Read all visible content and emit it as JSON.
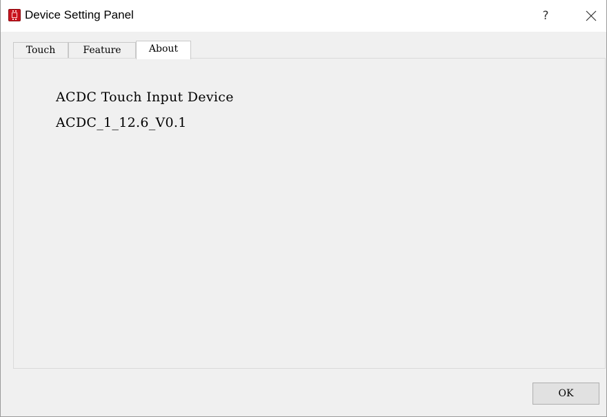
{
  "window": {
    "title": "Device Setting Panel",
    "help_label": "?",
    "app_icon": "chip-icon",
    "close_icon": "close-icon"
  },
  "tabs": [
    {
      "label": "Touch",
      "active": false
    },
    {
      "label": "Feature",
      "active": false
    },
    {
      "label": "About",
      "active": true
    }
  ],
  "about": {
    "device_name": "ACDC Touch Input Device",
    "version": "ACDC_1_12.6_V0.1"
  },
  "footer": {
    "ok_label": "OK"
  },
  "colors": {
    "app_icon": "#c8141e",
    "window_bg": "#f0f0f0",
    "titlebar_bg": "#ffffff"
  }
}
